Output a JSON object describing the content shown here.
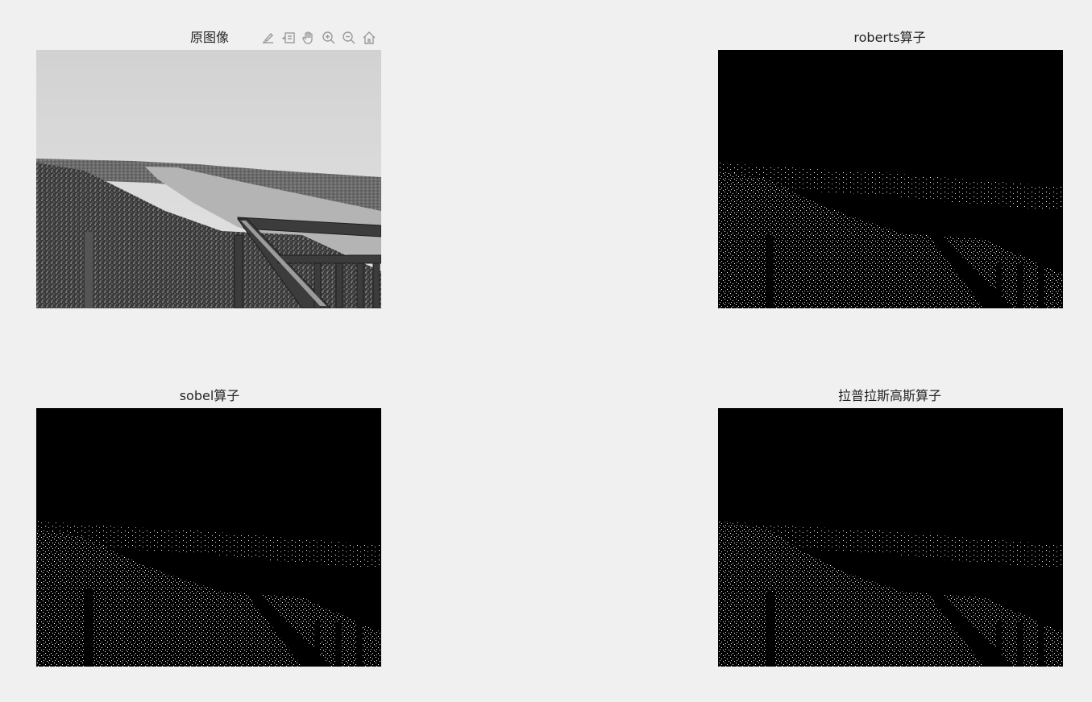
{
  "window": {
    "background": "#f0f0f0"
  },
  "axes": [
    {
      "title": "原图像",
      "kind": "grayscale-photo"
    },
    {
      "title": "roberts算子",
      "kind": "edge-map"
    },
    {
      "title": "sobel算子",
      "kind": "edge-map"
    },
    {
      "title": "拉普拉斯高斯算子",
      "kind": "edge-map"
    }
  ],
  "toolbar": {
    "buttons": [
      {
        "icon": "brush-icon",
        "label": "Brush"
      },
      {
        "icon": "data-tips-icon",
        "label": "Data Tips"
      },
      {
        "icon": "pan-hand-icon",
        "label": "Pan"
      },
      {
        "icon": "zoom-in-icon",
        "label": "Zoom In"
      },
      {
        "icon": "zoom-out-icon",
        "label": "Zoom Out"
      },
      {
        "icon": "home-icon",
        "label": "Restore View"
      }
    ],
    "icon_color": "#9a9a9a"
  }
}
